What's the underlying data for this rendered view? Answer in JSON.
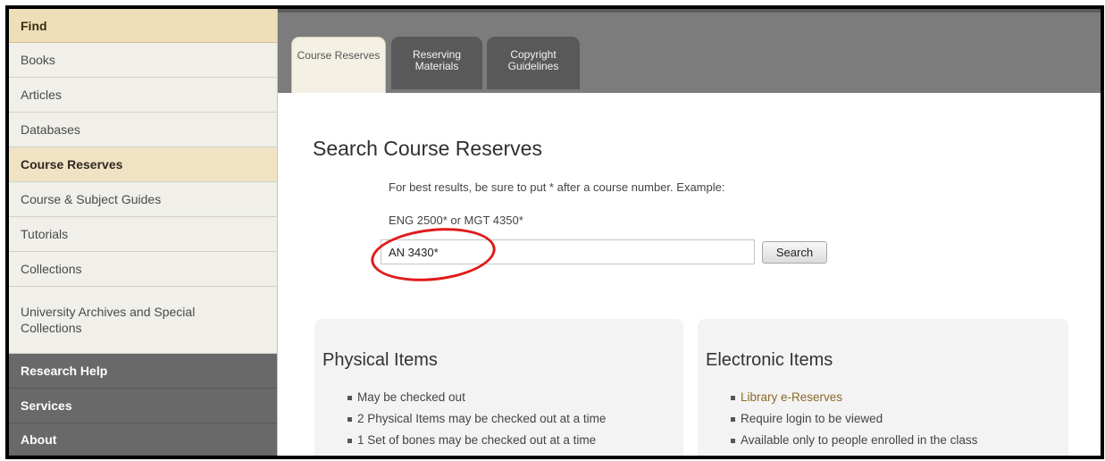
{
  "sidebar": {
    "items": [
      {
        "label": "Find",
        "style": "heading"
      },
      {
        "label": "Books"
      },
      {
        "label": "Articles"
      },
      {
        "label": "Databases"
      },
      {
        "label": "Course Reserves",
        "style": "active"
      },
      {
        "label": "Course & Subject Guides"
      },
      {
        "label": "Tutorials"
      },
      {
        "label": "Collections"
      },
      {
        "label": "University Archives and Special Collections"
      },
      {
        "label": "Research Help",
        "style": "section"
      },
      {
        "label": "Services",
        "style": "section"
      },
      {
        "label": "About",
        "style": "section"
      }
    ]
  },
  "tabs": [
    {
      "label": "Course Reserves",
      "active": true
    },
    {
      "label": "Reserving Materials",
      "active": false
    },
    {
      "label": "Copyright Guidelines",
      "active": false
    }
  ],
  "main": {
    "title": "Search Course Reserves",
    "hint_line1": "For best results, be sure to put * after a course number. Example:",
    "hint_line2": "ENG 2500* or MGT 4350*",
    "search": {
      "value": "AN 3430*",
      "button_label": "Search"
    }
  },
  "physical": {
    "title": "Physical Items",
    "items": [
      "May be checked out",
      "2 Physical Items may be checked out at a time",
      "1 Set of bones may be checked out at a time"
    ]
  },
  "electronic": {
    "title": "Electronic Items",
    "items": [
      "Library e-Reserves",
      "Require login to be viewed",
      "Available only to people enrolled in the class"
    ]
  },
  "colors": {
    "annotation_circle": "#e01a1a",
    "link": "#8a6a28",
    "heading_bg": "#efdfb9",
    "section_bg": "#696969"
  }
}
